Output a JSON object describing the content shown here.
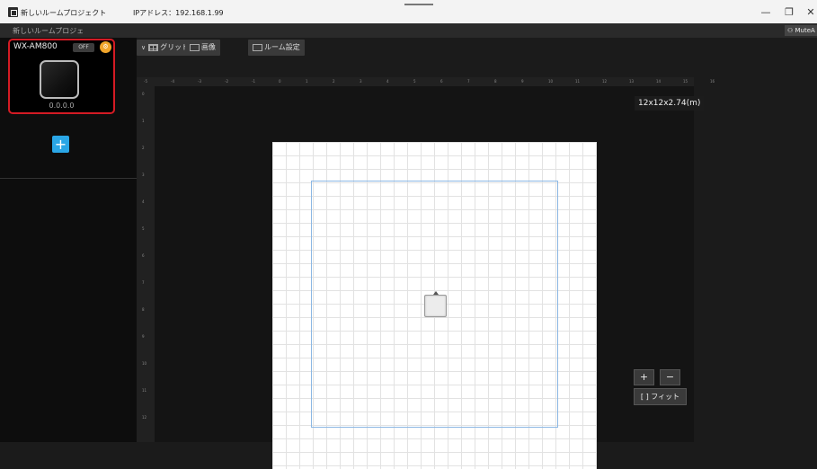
{
  "titlebar": {
    "app_title": "新しいルームプロジェクト",
    "ip_text": "IPアドレス：192.168.1.99",
    "minimize": "—",
    "maximize": "❐",
    "close": "✕"
  },
  "projectbar": {
    "project_name": "新しいルームプロジェ",
    "user_label": "MuteA"
  },
  "sidebar": {
    "device": {
      "name": "WX-AM800",
      "status": "OFF",
      "ip": "0.0.0.0"
    },
    "add_label": "+"
  },
  "toolbar": {
    "grid_label": "グリッド",
    "image_label": "画像",
    "room_settings_label": "ルーム設定"
  },
  "canvas": {
    "dimensions": "12x12x2.74(m)",
    "ruler_top": [
      "-5",
      "-4",
      "-3",
      "-2",
      "-1",
      "0",
      "1",
      "2",
      "3",
      "4",
      "5",
      "6",
      "7",
      "8",
      "9",
      "10",
      "11",
      "12",
      "13",
      "14",
      "15",
      "16"
    ],
    "ruler_left": [
      "0",
      "1",
      "2",
      "3",
      "4",
      "5",
      "6",
      "7",
      "8",
      "9",
      "10",
      "11",
      "12"
    ],
    "zoom_in": "+",
    "zoom_out": "−",
    "fit_label": "フィット",
    "fit_icon": "[ ]"
  }
}
